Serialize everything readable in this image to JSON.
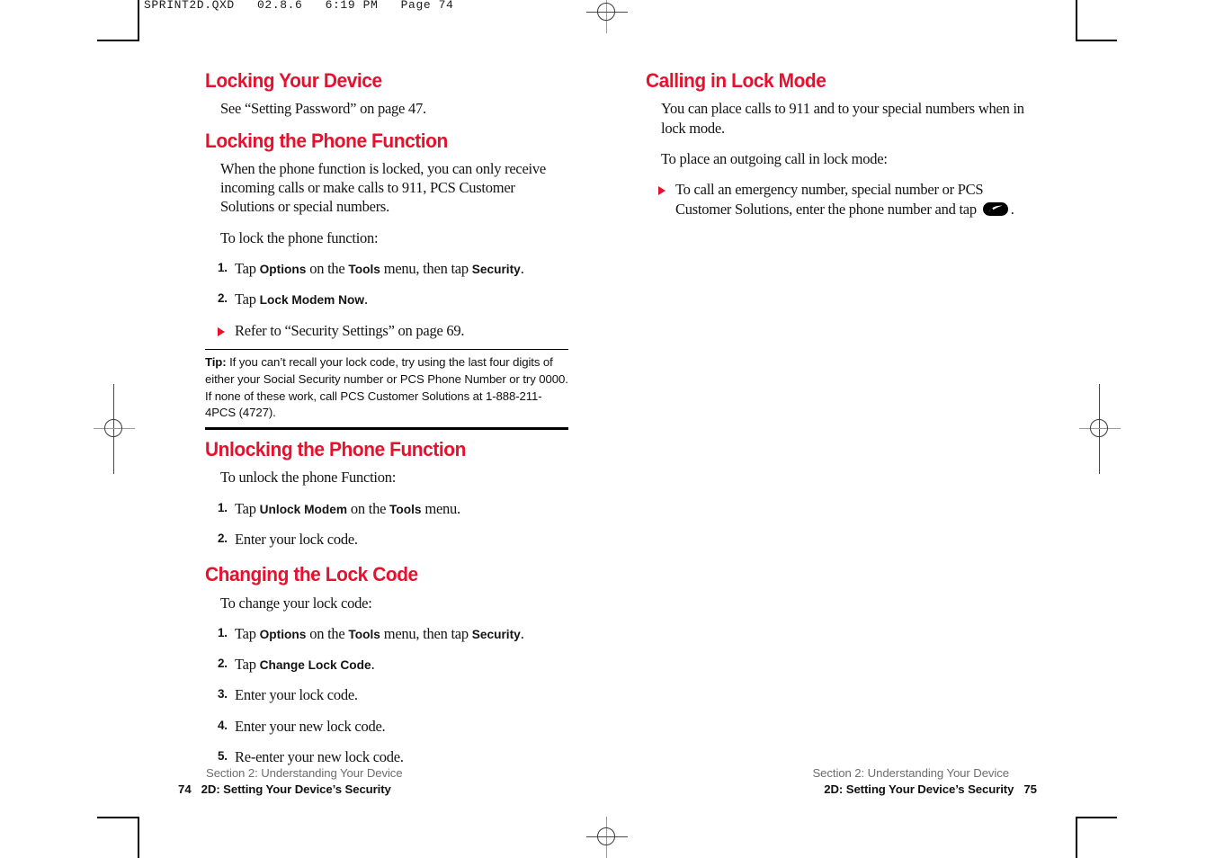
{
  "print_slug": "SPRINT2D.QXD   02.8.6   6:19 PM   Page 74",
  "colors": {
    "heading_red": "#E8112D",
    "body_black": "#141414",
    "footer_gray": "#6d6d6d"
  },
  "left_column": {
    "section1": {
      "heading": "Locking Your Device",
      "body": "See “Setting Password” on page 47."
    },
    "section2": {
      "heading": "Locking the Phone Function",
      "intro": "When the phone function is locked, you can only receive incoming calls or make calls to 911, PCS Customer Solutions or special numbers.",
      "lead": "To lock the phone function:",
      "steps": [
        {
          "num": "1.",
          "pre": "Tap ",
          "b1": "Options",
          "mid": " on the ",
          "b2": "Tools",
          "mid2": " menu, then tap ",
          "b3": "Security",
          "post": "."
        },
        {
          "num": "2.",
          "pre": "Tap ",
          "b1": "Lock Modem Now",
          "post": "."
        }
      ],
      "arrow_note": "Refer to “Security Settings” on page 69."
    },
    "tip": {
      "label": "Tip:",
      "text": " If you can’t recall your lock code, try using the last four digits of either your Social Security number or PCS Phone Number or try 0000. If none of these work, call PCS Customer Solutions at 1-888-211-4PCS (4727)."
    },
    "section3": {
      "heading": "Unlocking the Phone Function",
      "lead": "To unlock the phone Function:",
      "steps": [
        {
          "num": "1.",
          "pre": "Tap ",
          "b1": "Unlock Modem",
          "mid": " on the ",
          "b2": "Tools",
          "post": " menu."
        },
        {
          "num": "2.",
          "pre": "Enter your lock code.",
          "post": ""
        }
      ]
    },
    "section4": {
      "heading": "Changing the Lock Code",
      "lead": "To change your lock code:",
      "steps": [
        {
          "num": "1.",
          "pre": "Tap ",
          "b1": "Options",
          "mid": " on the ",
          "b2": "Tools",
          "mid2": " menu, then tap ",
          "b3": "Security",
          "post": "."
        },
        {
          "num": "2.",
          "pre": "Tap ",
          "b1": "Change Lock Code",
          "post": "."
        },
        {
          "num": "3.",
          "pre": "Enter your lock code.",
          "post": ""
        },
        {
          "num": "4.",
          "pre": "Enter your new lock code.",
          "post": ""
        },
        {
          "num": "5.",
          "pre": "Re-enter your new lock code.",
          "post": ""
        }
      ]
    }
  },
  "right_column": {
    "section1": {
      "heading": "Calling in Lock Mode",
      "intro": "You can place calls to 911 and to your special numbers when in lock mode.",
      "lead": "To place an outgoing call in lock mode:",
      "arrow_pre": "To call an emergency number, special number or PCS Customer Solutions, enter the phone number and tap ",
      "arrow_icon": "talk-key-icon",
      "arrow_post": "."
    }
  },
  "footer_left": {
    "section": "Section 2: Understanding Your Device",
    "subsection": "2D: Setting Your Device’s Security",
    "page": "74"
  },
  "footer_right": {
    "section": "Section 2: Understanding Your Device",
    "subsection": "2D: Setting Your Device’s Security",
    "page": "75"
  }
}
